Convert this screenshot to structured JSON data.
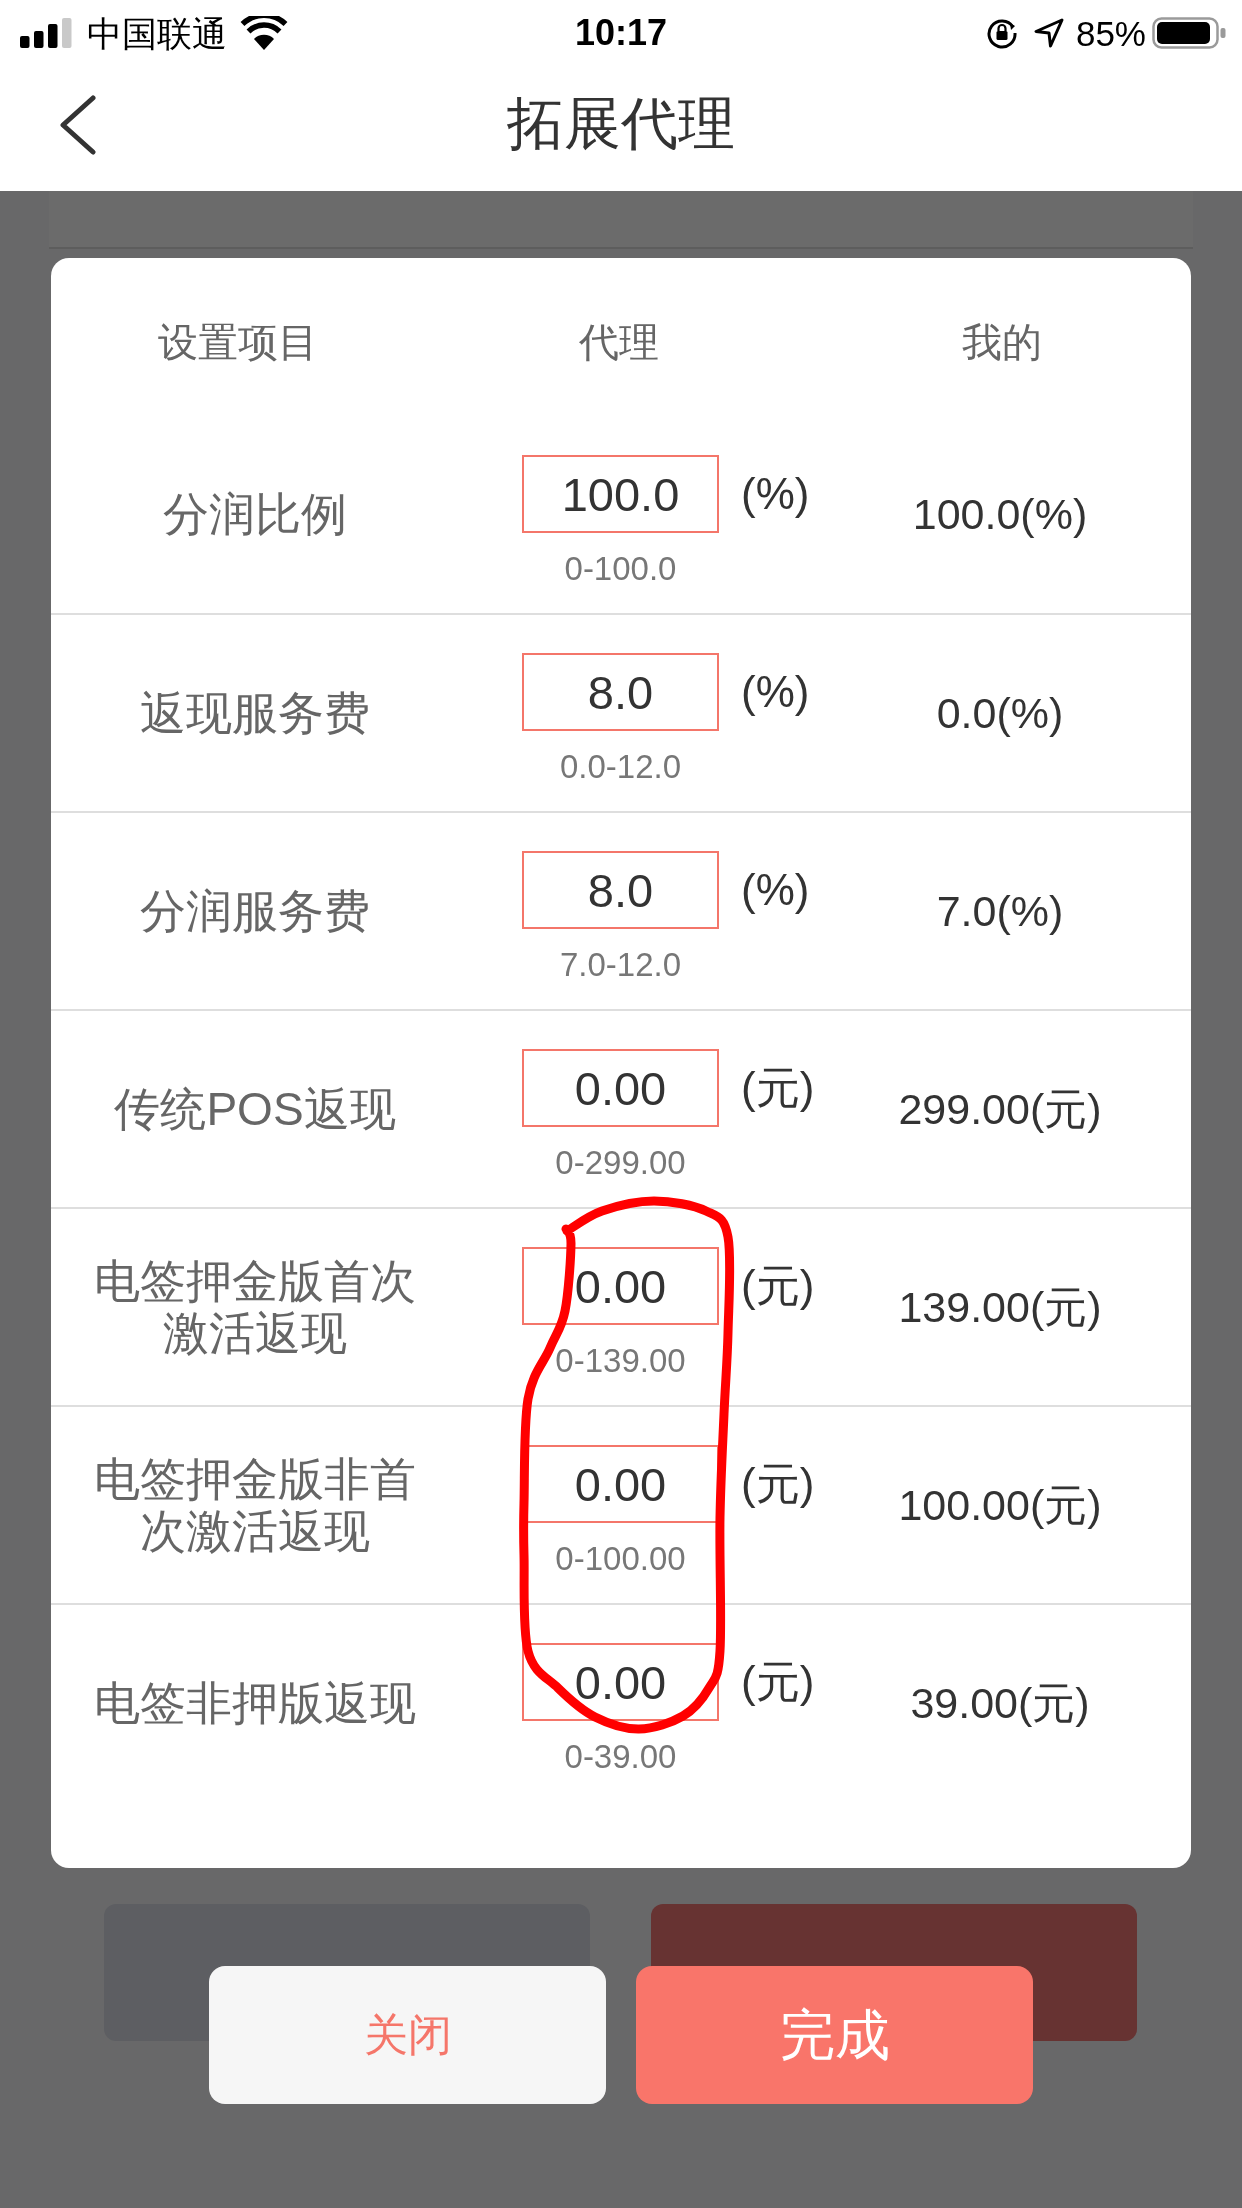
{
  "status_bar": {
    "carrier": "中国联通",
    "time": "10:17",
    "battery": "85%"
  },
  "nav_bar": {
    "title": "拓展代理"
  },
  "background_page": {
    "buttons": [
      {
        "kind": "neutral"
      },
      {
        "kind": "accent"
      }
    ]
  },
  "dialog": {
    "columns": [
      "设置项目",
      "代理",
      "我的"
    ],
    "rows": [
      {
        "label": "分润比例",
        "value": "100.0",
        "unit": "(%)",
        "range": "0-100.0",
        "mine": "100.0(%)"
      },
      {
        "label": "返现服务费",
        "value": "8.0",
        "unit": "(%)",
        "range": "0.0-12.0",
        "mine": "0.0(%)"
      },
      {
        "label": "分润服务费",
        "value": "8.0",
        "unit": "(%)",
        "range": "7.0-12.0",
        "mine": "7.0(%)"
      },
      {
        "label": "传统POS返现",
        "value": "0.00",
        "unit": "(元)",
        "range": "0-299.00",
        "mine": "299.00(元)"
      },
      {
        "label": "电签押金版首次激活返现",
        "value": "0.00",
        "unit": "(元)",
        "range": "0-139.00",
        "mine": "139.00(元)"
      },
      {
        "label": "电签押金版非首次激活返现",
        "value": "0.00",
        "unit": "(元)",
        "range": "0-100.00",
        "mine": "100.00(元)"
      },
      {
        "label": "电签非押版返现",
        "value": "0.00",
        "unit": "(元)",
        "range": "0-39.00",
        "mine": "39.00(元)"
      }
    ],
    "buttons": [
      {
        "label": "关闭",
        "kind": "secondary"
      },
      {
        "label": "完成",
        "kind": "primary"
      }
    ]
  },
  "annotation": {
    "kind": "freehand_loop"
  }
}
